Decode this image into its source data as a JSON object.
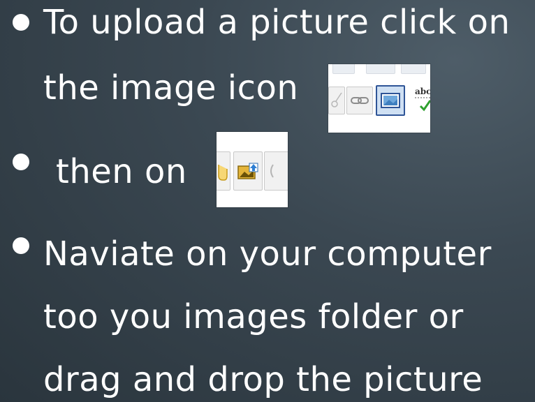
{
  "slide": {
    "bullets": [
      {
        "lines": [
          "To upload a picture click on",
          "the image icon"
        ]
      },
      {
        "lines": [
          "then on"
        ]
      },
      {
        "lines": [
          "Naviate on your computer",
          "too you images folder or",
          "drag and drop the picture"
        ]
      }
    ]
  },
  "toolbar_screenshot_1": {
    "spell_check_label": "abc",
    "icons": [
      "scissors-icon",
      "link-icon",
      "image-icon",
      "spellcheck-icon"
    ]
  },
  "toolbar_screenshot_2": {
    "icons": [
      "hand-icon",
      "upload-image-icon"
    ]
  },
  "colors": {
    "background": "#3b4852",
    "text": "#ffffff",
    "highlight": "#2f5597"
  }
}
